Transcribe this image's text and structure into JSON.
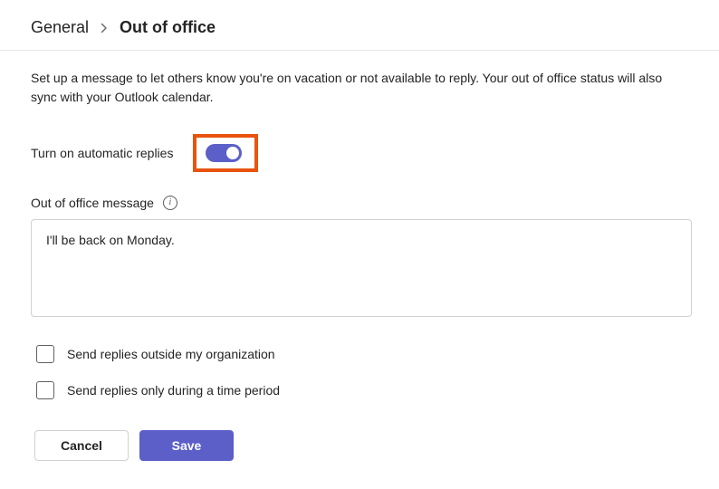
{
  "breadcrumb": {
    "root": "General",
    "current": "Out of office"
  },
  "description": "Set up a message to let others know you're on vacation or not available to reply. Your out of office status will also sync with your Outlook calendar.",
  "toggle": {
    "label": "Turn on automatic replies",
    "on": true
  },
  "message": {
    "label": "Out of office message",
    "value": "I'll be back on Monday."
  },
  "checkboxes": {
    "outside": {
      "label": "Send replies outside my organization",
      "checked": false
    },
    "period": {
      "label": "Send replies only during a time period",
      "checked": false
    }
  },
  "buttons": {
    "cancel": "Cancel",
    "save": "Save"
  }
}
